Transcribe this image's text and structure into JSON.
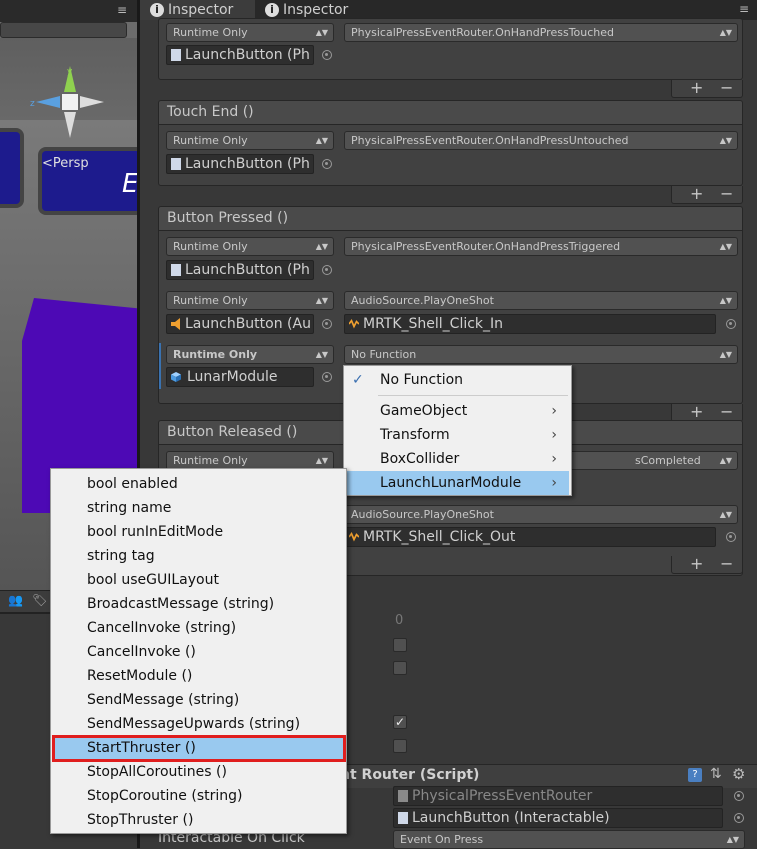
{
  "tabs": [
    {
      "label": "Inspector",
      "icon": "info-icon"
    },
    {
      "label": "Inspector",
      "icon": "info-icon"
    }
  ],
  "scene": {
    "persp_label": "Persp",
    "partial_text": "E"
  },
  "events": {
    "top_entry": {
      "runtime": "Runtime Only",
      "function": "PhysicalPressEventRouter.OnHandPressTouched",
      "object": "LaunchButton (Ph"
    },
    "touch_end": {
      "title": "Touch End ()",
      "entry": {
        "runtime": "Runtime Only",
        "function": "PhysicalPressEventRouter.OnHandPressUntouched",
        "object": "LaunchButton (Ph"
      }
    },
    "button_pressed": {
      "title": "Button Pressed ()",
      "entries": [
        {
          "runtime": "Runtime Only",
          "function": "PhysicalPressEventRouter.OnHandPressTriggered",
          "object": "LaunchButton (Ph"
        },
        {
          "runtime": "Runtime Only",
          "function": "AudioSource.PlayOneShot",
          "object": "LaunchButton (Au",
          "argument": "MRTK_Shell_Click_In"
        },
        {
          "runtime": "Runtime Only",
          "function": "No Function",
          "object": "LunarModule"
        }
      ]
    },
    "button_released": {
      "title": "Button Released ()",
      "entries": [
        {
          "runtime": "Runtime Only",
          "function_partial": "sCompleted"
        },
        {
          "function": "AudioSource.PlayOneShot",
          "argument": "MRTK_Shell_Click_Out"
        }
      ]
    },
    "plus": "+",
    "minus": "−"
  },
  "lower": {
    "value_zero": "0",
    "component_title": "nt Router (Script)",
    "script_field": "PhysicalPressEventRouter",
    "interactable_field": "LaunchButton (Interactable)",
    "interactable_on_click_label": "Interactable On Click",
    "event_on_press": "Event On Press",
    "checkbox_checked": true
  },
  "function_menu": {
    "items": [
      {
        "label": "No Function",
        "checked": true
      },
      {
        "label": "GameObject",
        "submenu": true
      },
      {
        "label": "Transform",
        "submenu": true
      },
      {
        "label": "BoxCollider",
        "submenu": true
      },
      {
        "label": "LaunchLunarModule",
        "submenu": true,
        "highlighted": true
      }
    ]
  },
  "method_menu": {
    "items": [
      "bool enabled",
      "string name",
      "bool runInEditMode",
      "string tag",
      "bool useGUILayout",
      "BroadcastMessage (string)",
      "CancelInvoke (string)",
      "CancelInvoke ()",
      "ResetModule ()",
      "SendMessage (string)",
      "SendMessageUpwards (string)",
      "StartThruster ()",
      "StopAllCoroutines ()",
      "StopCoroutine (string)",
      "StopThruster ()"
    ],
    "highlighted_index": 11
  },
  "colors": {
    "highlight": "#99c9ef",
    "callout": "#e01e1e",
    "purple_object": "#4d09b5"
  }
}
